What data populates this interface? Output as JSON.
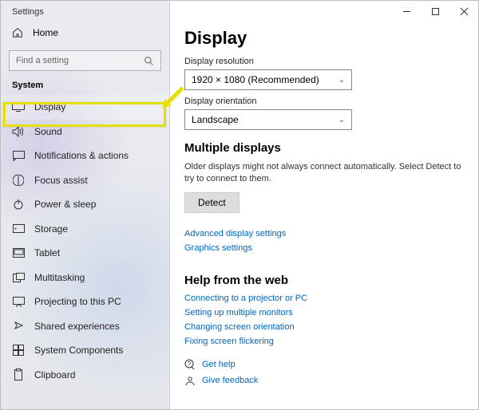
{
  "window": {
    "title": "Settings"
  },
  "sidebar": {
    "home_label": "Home",
    "search_placeholder": "Find a setting",
    "section_label": "System",
    "items": [
      {
        "label": "Display"
      },
      {
        "label": "Sound"
      },
      {
        "label": "Notifications & actions"
      },
      {
        "label": "Focus assist"
      },
      {
        "label": "Power & sleep"
      },
      {
        "label": "Storage"
      },
      {
        "label": "Tablet"
      },
      {
        "label": "Multitasking"
      },
      {
        "label": "Projecting to this PC"
      },
      {
        "label": "Shared experiences"
      },
      {
        "label": "System Components"
      },
      {
        "label": "Clipboard"
      }
    ]
  },
  "main": {
    "title": "Display",
    "resolution_label": "Display resolution",
    "resolution_value": "1920 × 1080 (Recommended)",
    "orientation_label": "Display orientation",
    "orientation_value": "Landscape",
    "multi_title": "Multiple displays",
    "multi_body": "Older displays might not always connect automatically. Select Detect to try to connect to them.",
    "detect_label": "Detect",
    "adv_link": "Advanced display settings",
    "gfx_link": "Graphics settings",
    "help_title": "Help from the web",
    "help_links": [
      "Connecting to a projector or PC",
      "Setting up multiple monitors",
      "Changing screen orientation",
      "Fixing screen flickering"
    ],
    "get_help": "Get help",
    "feedback": "Give feedback"
  }
}
